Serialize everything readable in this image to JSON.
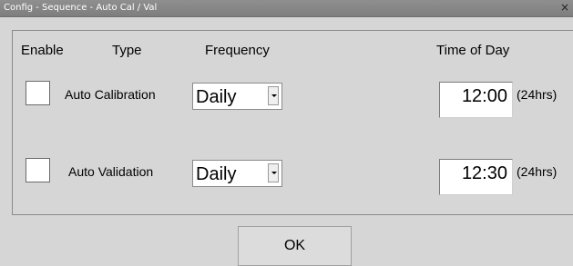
{
  "window": {
    "title": "Config - Sequence - Auto Cal / Val",
    "close_glyph": "×"
  },
  "headers": {
    "enable": "Enable",
    "type": "Type",
    "frequency": "Frequency",
    "time_of_day": "Time of Day"
  },
  "rows": [
    {
      "label": "Auto Calibration",
      "enabled": false,
      "frequency": "Daily",
      "time": "12:00",
      "unit": "(24hrs)"
    },
    {
      "label": "Auto Validation",
      "enabled": false,
      "frequency": "Daily",
      "time": "12:30",
      "unit": "(24hrs)"
    }
  ],
  "ok_label": "OK",
  "icons": {
    "close": "close-icon",
    "dropdown": "chevron-down-icon"
  }
}
